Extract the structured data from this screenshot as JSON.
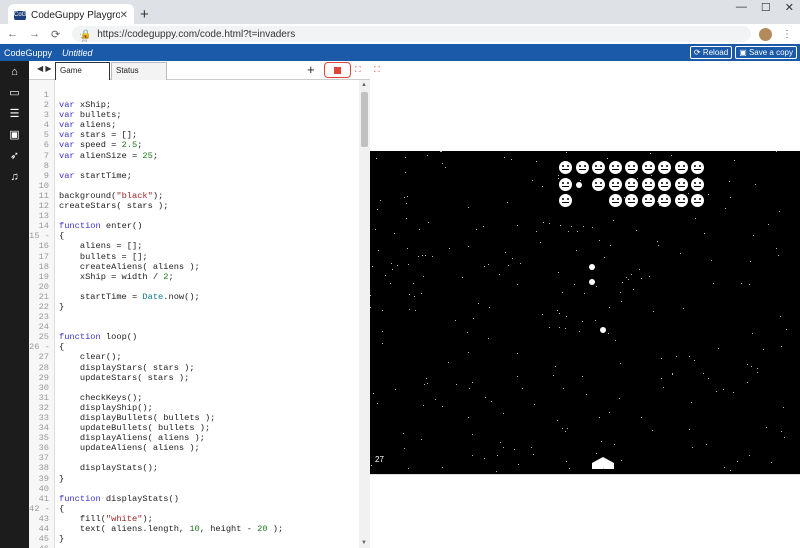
{
  "browser": {
    "tab_title": "CodeGuppy Playground",
    "favicon_text": "CoGu",
    "url": "https://codeguppy.com/code.html?t=invaders"
  },
  "app": {
    "brand": "CodeGuppy",
    "project_name": "Untitled",
    "reload_label": "⟳ Reload",
    "save_label": "▣ Save a copy"
  },
  "sidebar": {
    "icons": [
      "home-icon",
      "book-icon",
      "list-icon",
      "image-icon",
      "rocket-icon",
      "music-icon"
    ]
  },
  "editor": {
    "tabs": [
      {
        "label": "Game"
      },
      {
        "label": "Status"
      }
    ],
    "plus_label": "+",
    "lines": [
      {
        "n": "1",
        "t": ""
      },
      {
        "n": "2",
        "t": "var xShip;"
      },
      {
        "n": "3",
        "t": "var bullets;"
      },
      {
        "n": "4",
        "t": "var aliens;"
      },
      {
        "n": "5",
        "t": "var stars = [];"
      },
      {
        "n": "6",
        "t": "var speed = 2.5;"
      },
      {
        "n": "7",
        "t": "var alienSize = 25;"
      },
      {
        "n": "8",
        "t": ""
      },
      {
        "n": "9",
        "t": "var startTime;"
      },
      {
        "n": "10",
        "t": ""
      },
      {
        "n": "11",
        "t": "background(\"black\");"
      },
      {
        "n": "12",
        "t": "createStars( stars );"
      },
      {
        "n": "13",
        "t": ""
      },
      {
        "n": "14",
        "t": "function enter()"
      },
      {
        "n": "15 -",
        "t": "{"
      },
      {
        "n": "16",
        "t": "    aliens = [];"
      },
      {
        "n": "17",
        "t": "    bullets = [];"
      },
      {
        "n": "18",
        "t": "    createAliens( aliens );"
      },
      {
        "n": "19",
        "t": "    xShip = width / 2;"
      },
      {
        "n": "20",
        "t": ""
      },
      {
        "n": "21",
        "t": "    startTime = Date.now();"
      },
      {
        "n": "22",
        "t": "}"
      },
      {
        "n": "23",
        "t": ""
      },
      {
        "n": "24",
        "t": ""
      },
      {
        "n": "25",
        "t": "function loop()"
      },
      {
        "n": "26 -",
        "t": "{"
      },
      {
        "n": "27",
        "t": "    clear();"
      },
      {
        "n": "28",
        "t": "    displayStars( stars );"
      },
      {
        "n": "29",
        "t": "    updateStars( stars );"
      },
      {
        "n": "30",
        "t": ""
      },
      {
        "n": "31",
        "t": "    checkKeys();"
      },
      {
        "n": "32",
        "t": "    displayShip();"
      },
      {
        "n": "33",
        "t": "    displayBullets( bullets );"
      },
      {
        "n": "34",
        "t": "    updateBullets( bullets );"
      },
      {
        "n": "35",
        "t": "    displayAliens( aliens );"
      },
      {
        "n": "36",
        "t": "    updateAliens( aliens );"
      },
      {
        "n": "37",
        "t": ""
      },
      {
        "n": "38",
        "t": "    displayStats();"
      },
      {
        "n": "39",
        "t": "}"
      },
      {
        "n": "40",
        "t": ""
      },
      {
        "n": "41",
        "t": "function displayStats()"
      },
      {
        "n": "42 -",
        "t": "{"
      },
      {
        "n": "43",
        "t": "    fill(\"white\");"
      },
      {
        "n": "44",
        "t": "    text( aliens.length, 10, height - 20 );"
      },
      {
        "n": "45",
        "t": "}"
      },
      {
        "n": "46",
        "t": ""
      },
      {
        "n": "47",
        "t": "function createStars( ar )"
      }
    ]
  },
  "game": {
    "aliens_remaining": "27"
  }
}
